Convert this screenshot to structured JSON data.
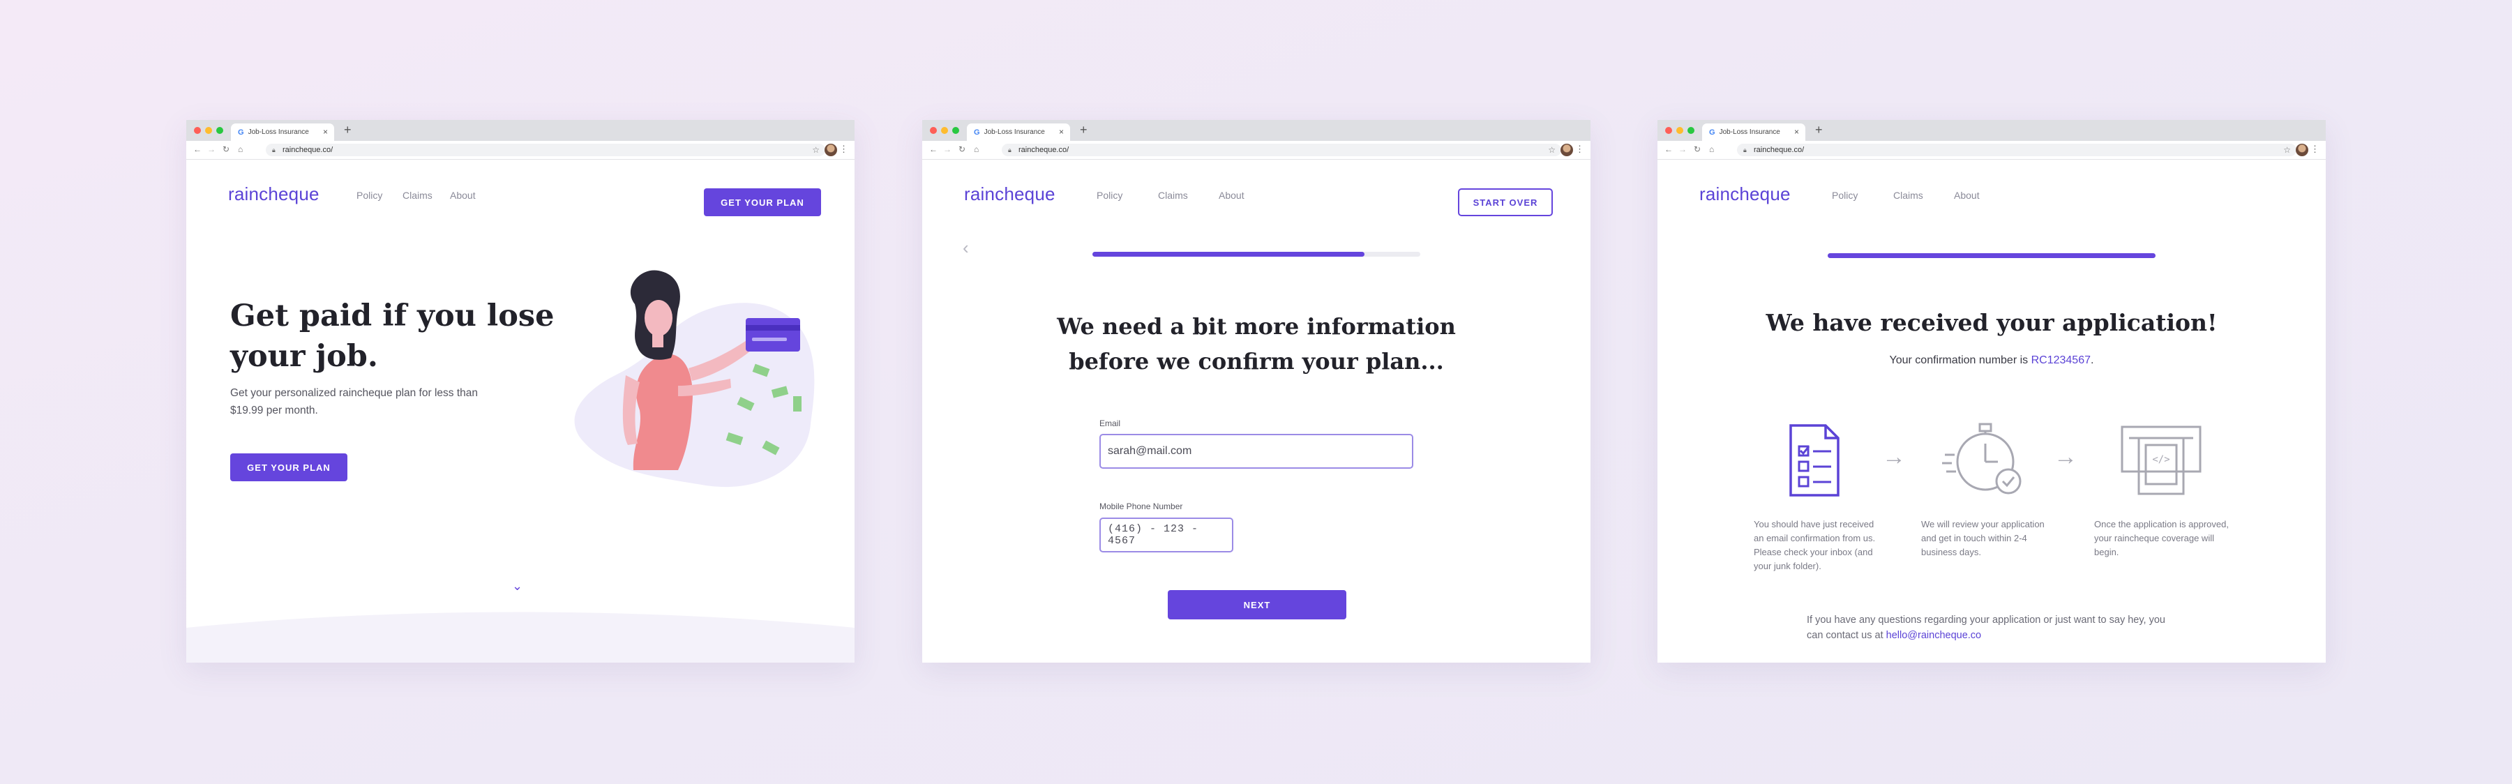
{
  "browser": {
    "tab_title": "Job-Loss Insurance",
    "tab_favicon": "G",
    "tab_close": "×",
    "new_tab": "+",
    "url": "raincheque.co/"
  },
  "brand": {
    "logo": "raincheque",
    "accent": "#6545dd",
    "nav": [
      "Policy",
      "Claims",
      "About"
    ]
  },
  "screen1": {
    "cta_top": "GET YOUR PLAN",
    "headline_line1": "Get paid if you lose",
    "headline_line2": "your job.",
    "sub_line1": "Get your personalized raincheque plan for less than",
    "sub_line2": "$19.99 per month.",
    "cta_main": "GET YOUR PLAN"
  },
  "screen2": {
    "start_over": "START OVER",
    "progress": 0.83,
    "heading_line1": "We need a bit more information",
    "heading_line2": "before we confirm your plan...",
    "email_label": "Email",
    "email_value": "sarah@mail.com",
    "phone_label": "Mobile Phone Number",
    "phone_value": "(416) - 123 - 4567",
    "next": "NEXT"
  },
  "screen3": {
    "progress": 1.0,
    "heading": "We have received your application!",
    "confirm_prefix": "Your confirmation number is ",
    "confirm_number": "RC1234567",
    "confirm_suffix": ".",
    "steps": [
      {
        "icon": "checklist-icon",
        "lines": [
          "You should have just received",
          "an email confirmation from us.",
          "Please check your inbox (and",
          "your junk folder)."
        ]
      },
      {
        "icon": "stopwatch-icon",
        "lines": [
          "We will review your application",
          "and get in touch within 2-4",
          "business days."
        ]
      },
      {
        "icon": "atm-icon",
        "lines": [
          "Once the application is approved,",
          "your raincheque coverage will",
          "begin."
        ]
      }
    ],
    "footer_line1": "If you have any questions regarding your application or just want to say hey, you",
    "footer_line2_prefix": "can contact us at ",
    "footer_email": "hello@raincheque.co"
  }
}
